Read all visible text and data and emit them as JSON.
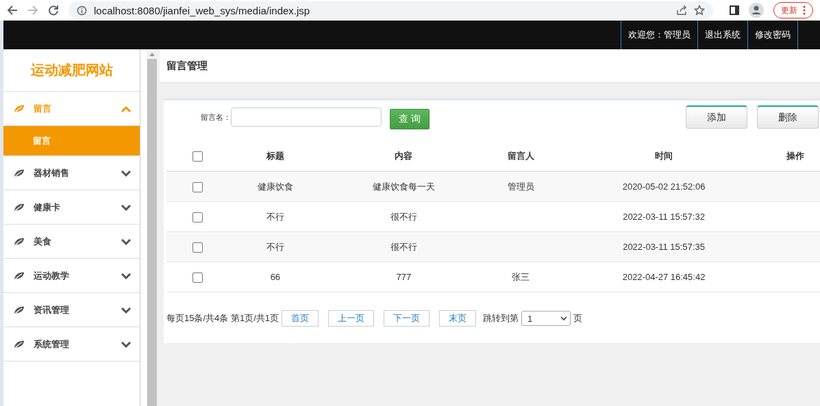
{
  "browser": {
    "url": "localhost:8080/jianfei_web_sys/media/index.jsp",
    "update_label": "更新"
  },
  "header": {
    "links": [
      "欢迎您：管理员",
      "退出系统",
      "修改密码"
    ]
  },
  "sidebar": {
    "title": "运动减肥网站",
    "menus": [
      {
        "label": "留言",
        "expanded": true,
        "children": [
          {
            "label": "留言",
            "selected": true
          }
        ]
      },
      {
        "label": "器材销售",
        "expanded": false
      },
      {
        "label": "健康卡",
        "expanded": false
      },
      {
        "label": "美食",
        "expanded": false
      },
      {
        "label": "运动教学",
        "expanded": false
      },
      {
        "label": "资讯管理",
        "expanded": false
      },
      {
        "label": "系统管理",
        "expanded": false
      }
    ]
  },
  "page_title": "留言管理",
  "search": {
    "label": "留言名：",
    "button": "查 询"
  },
  "actions": [
    "添加",
    "删除"
  ],
  "table": {
    "all_checked": false,
    "columns": [
      "标题",
      "内容",
      "留言人",
      "时间",
      "操作"
    ],
    "rows": [
      {
        "checked": false,
        "title": "健康饮食",
        "content": "健康饮食每一天",
        "author": "管理员",
        "time": "2020-05-02 21:52:06"
      },
      {
        "checked": false,
        "title": "不行",
        "content": "很不行",
        "time": "2022-03-11 15:57:32"
      },
      {
        "checked": false,
        "title": "不行",
        "content": "很不行",
        "time": "2022-03-11 15:57:35"
      },
      {
        "checked": false,
        "title": "66",
        "content": "777",
        "author": "张三",
        "time": "2022-04-27 16:45:42"
      }
    ]
  },
  "pagination": {
    "summary": "每页15条/共4条 第1页/共1页",
    "buttons": [
      "首页",
      "上一页",
      "下一页",
      "末页"
    ],
    "jump_label": "跳转到第",
    "page": "1",
    "page_suffix": "页"
  }
}
